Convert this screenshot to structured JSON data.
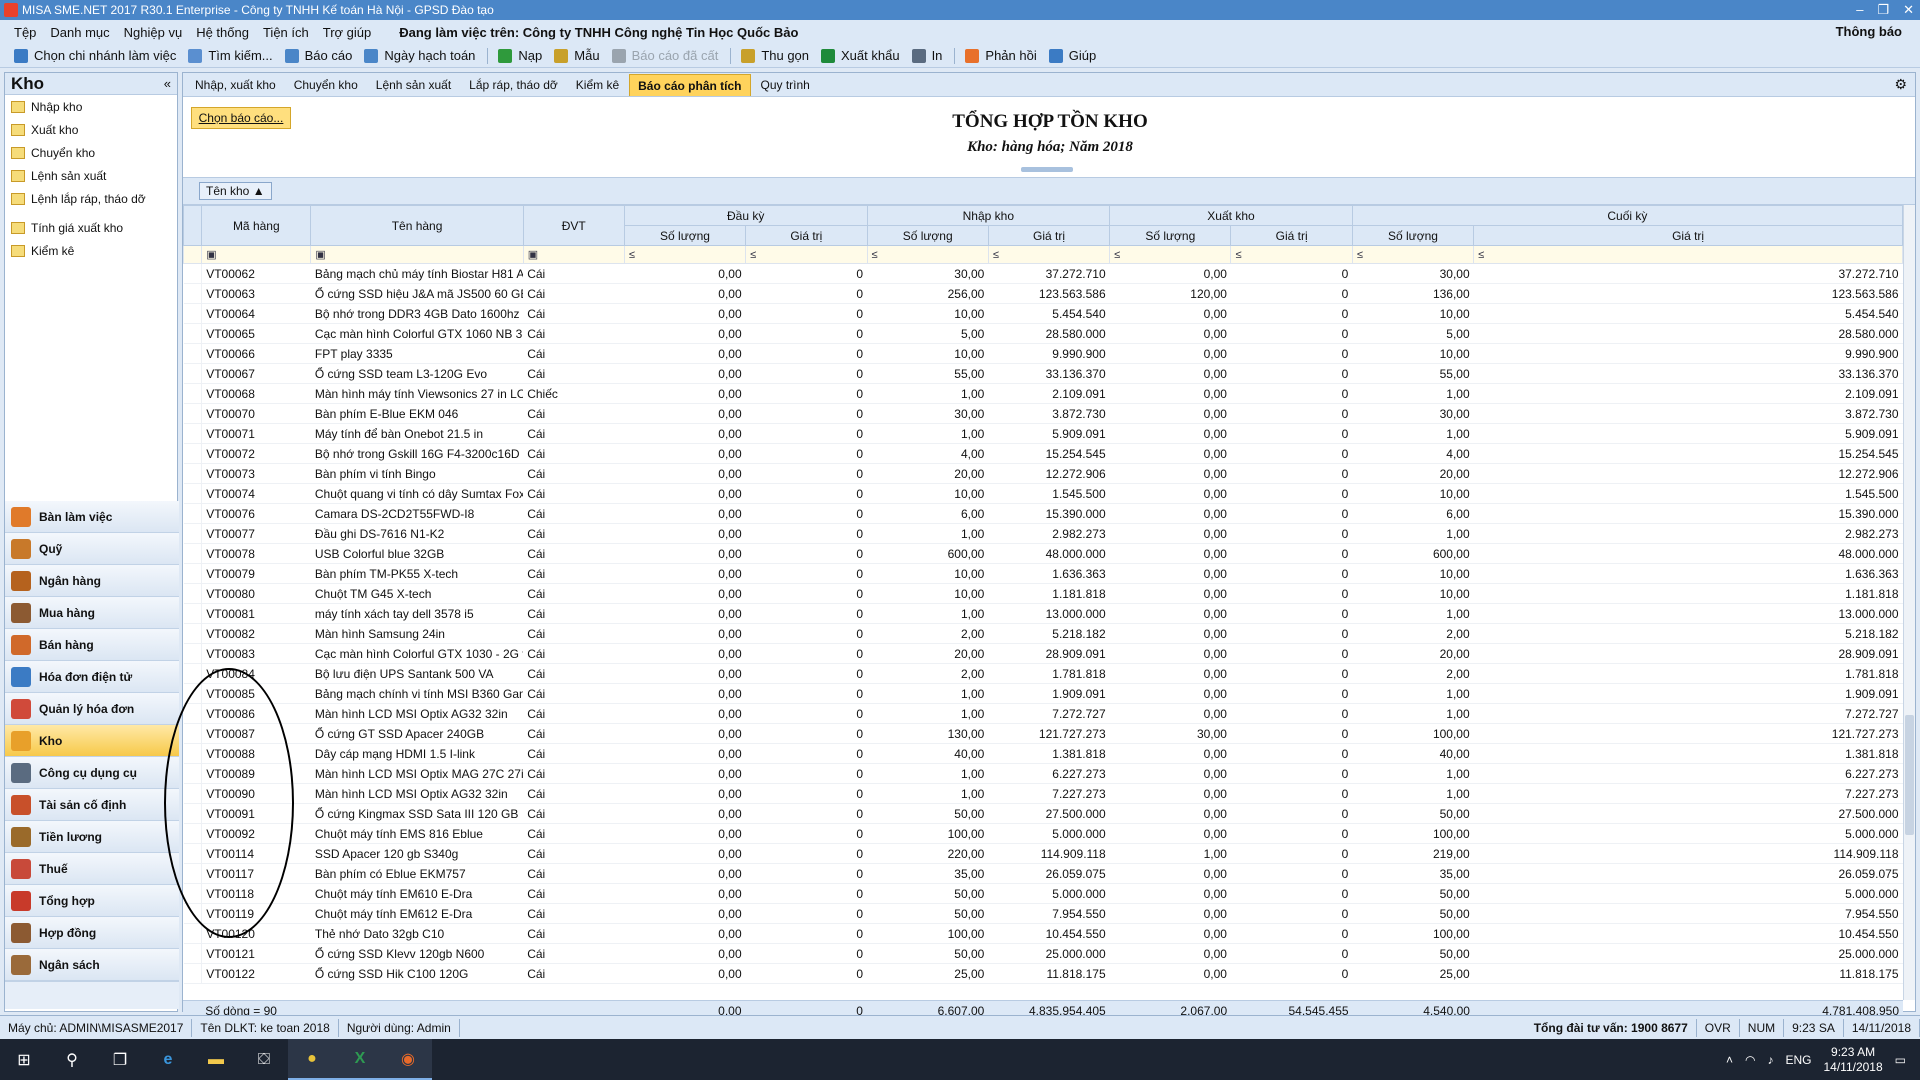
{
  "window": {
    "title": "MISA SME.NET 2017 R30.1 Enterprise - Công ty TNHH Kế toán Hà Nội - GPSD Đào tạo",
    "controls": [
      "–",
      "❐",
      "✕"
    ]
  },
  "menu": {
    "items": [
      "Tệp",
      "Danh mục",
      "Nghiệp vụ",
      "Hệ thống",
      "Tiện ích",
      "Trợ giúp"
    ],
    "working_on": "Đang làm việc trên: Công ty TNHH Công nghệ Tin Học Quốc Bảo",
    "notification": "Thông báo"
  },
  "toolbar": {
    "items": [
      {
        "label": "Chọn chi nhánh làm việc",
        "color": "#3b7bc4"
      },
      {
        "label": "Tìm kiếm...",
        "color": "#5a8fd0"
      },
      {
        "label": "Báo cáo",
        "color": "#4a86c8"
      },
      {
        "label": "Ngày hạch toán",
        "color": "#4a86c8"
      },
      {
        "label": "Nạp",
        "color": "#2f9a3c"
      },
      {
        "label": "Mẫu",
        "color": "#c8a02a"
      },
      {
        "label": "Báo cáo đã cất",
        "color": "#9aa4ae",
        "disabled": true
      },
      {
        "label": "Thu gọn",
        "color": "#c8a02a"
      },
      {
        "label": "Xuất khẩu",
        "color": "#1e8a3a"
      },
      {
        "label": "In",
        "color": "#5a6b80"
      },
      {
        "label": "Phản hồi",
        "color": "#e8702a"
      },
      {
        "label": "Giúp",
        "color": "#3b7bc4"
      }
    ]
  },
  "sidebar": {
    "title": "Kho",
    "collapse": "«",
    "items": [
      "Nhập kho",
      "Xuất kho",
      "Chuyển kho",
      "Lệnh sản xuất",
      "Lệnh lắp ráp, tháo dỡ"
    ],
    "items2": [
      "Tính giá xuất kho",
      "Kiểm kê"
    ],
    "modules": [
      "Bàn làm việc",
      "Quỹ",
      "Ngân hàng",
      "Mua hàng",
      "Bán hàng",
      "Hóa đơn điện tử",
      "Quản lý hóa đơn",
      "Kho",
      "Công cụ dụng cụ",
      "Tài sản cố định",
      "Tiền lương",
      "Thuế",
      "Tổng hợp",
      "Hợp đồng",
      "Ngân sách"
    ],
    "active_module": "Kho"
  },
  "tabs": {
    "items": [
      "Nhập, xuất kho",
      "Chuyển kho",
      "Lệnh sản xuất",
      "Lắp ráp, tháo dỡ",
      "Kiểm kê",
      "Báo cáo phân tích",
      "Quy trình"
    ],
    "active": "Báo cáo phân tích"
  },
  "report": {
    "choose_button": "Chọn báo cáo...",
    "title": "TỔNG HỢP TỒN KHO",
    "subtitle": "Kho: hàng hóa; Năm 2018",
    "group_chip": "Tên kho",
    "headers": {
      "code": "Mã hàng",
      "name": "Tên hàng",
      "unit": "ĐVT",
      "opening": "Đầu kỳ",
      "in": "Nhập kho",
      "out": "Xuất kho",
      "closing": "Cuối kỳ",
      "qty": "Số lượng",
      "value": "Giá trị"
    },
    "filter_op": "≤",
    "rows": [
      [
        "VT00062",
        "Bảng mạch chủ máy tính Biostar H81 A",
        "Cái",
        "0,00",
        "0",
        "30,00",
        "37.272.710",
        "0,00",
        "0",
        "30,00",
        "37.272.710"
      ],
      [
        "VT00063",
        "Ổ cứng SSD hiệu J&A mã JS500 60 GB",
        "Cái",
        "0,00",
        "0",
        "256,00",
        "123.563.586",
        "120,00",
        "0",
        "136,00",
        "123.563.586"
      ],
      [
        "VT00064",
        "Bộ nhớ trong DDR3 4GB Dato 1600hz",
        "Cái",
        "0,00",
        "0",
        "10,00",
        "5.454.540",
        "0,00",
        "0",
        "10,00",
        "5.454.540"
      ],
      [
        "VT00065",
        "Cạc màn hình Colorful GTX 1060 NB 3",
        "Cái",
        "0,00",
        "0",
        "5,00",
        "28.580.000",
        "0,00",
        "0",
        "5,00",
        "28.580.000"
      ],
      [
        "VT00066",
        "FPT play 3335",
        "Cái",
        "0,00",
        "0",
        "10,00",
        "9.990.900",
        "0,00",
        "0",
        "10,00",
        "9.990.900"
      ],
      [
        "VT00067",
        "Ổ cứng SSD team L3-120G Evo",
        "Cái",
        "0,00",
        "0",
        "55,00",
        "33.136.370",
        "0,00",
        "0",
        "55,00",
        "33.136.370"
      ],
      [
        "VT00068",
        "Màn hình máy tính Viewsonics 27 in LC",
        "Chiếc",
        "0,00",
        "0",
        "1,00",
        "2.109.091",
        "0,00",
        "0",
        "1,00",
        "2.109.091"
      ],
      [
        "VT00070",
        "Bàn phím E-Blue EKM 046",
        "Cái",
        "0,00",
        "0",
        "30,00",
        "3.872.730",
        "0,00",
        "0",
        "30,00",
        "3.872.730"
      ],
      [
        "VT00071",
        "Máy tính để bàn Onebot 21.5 in",
        "Cái",
        "0,00",
        "0",
        "1,00",
        "5.909.091",
        "0,00",
        "0",
        "1,00",
        "5.909.091"
      ],
      [
        "VT00072",
        "Bộ nhớ trong Gskill 16G F4-3200c16D",
        "Cái",
        "0,00",
        "0",
        "4,00",
        "15.254.545",
        "0,00",
        "0",
        "4,00",
        "15.254.545"
      ],
      [
        "VT00073",
        "Bàn phím vi tính Bingo",
        "Cái",
        "0,00",
        "0",
        "20,00",
        "12.272.906",
        "0,00",
        "0",
        "20,00",
        "12.272.906"
      ],
      [
        "VT00074",
        "Chuột quang vi tính có dây Sumtax Fox",
        "Cái",
        "0,00",
        "0",
        "10,00",
        "1.545.500",
        "0,00",
        "0",
        "10,00",
        "1.545.500"
      ],
      [
        "VT00076",
        "Camara DS-2CD2T55FWD-I8",
        "Cái",
        "0,00",
        "0",
        "6,00",
        "15.390.000",
        "0,00",
        "0",
        "6,00",
        "15.390.000"
      ],
      [
        "VT00077",
        "Đầu ghi DS-7616 N1-K2",
        "Cái",
        "0,00",
        "0",
        "1,00",
        "2.982.273",
        "0,00",
        "0",
        "1,00",
        "2.982.273"
      ],
      [
        "VT00078",
        " USB Colorful  blue 32GB",
        "Cái",
        "0,00",
        "0",
        "600,00",
        "48.000.000",
        "0,00",
        "0",
        "600,00",
        "48.000.000"
      ],
      [
        "VT00079",
        "Bàn phím TM-PK55 X-tech",
        "Cái",
        "0,00",
        "0",
        "10,00",
        "1.636.363",
        "0,00",
        "0",
        "10,00",
        "1.636.363"
      ],
      [
        "VT00080",
        "Chuột TM G45 X-tech",
        "Cái",
        "0,00",
        "0",
        "10,00",
        "1.181.818",
        "0,00",
        "0",
        "10,00",
        "1.181.818"
      ],
      [
        "VT00081",
        "máy tính xách tay dell 3578 i5",
        "Cái",
        "0,00",
        "0",
        "1,00",
        "13.000.000",
        "0,00",
        "0",
        "1,00",
        "13.000.000"
      ],
      [
        "VT00082",
        "Màn hình Samsung 24in",
        "Cái",
        "0,00",
        "0",
        "2,00",
        "5.218.182",
        "0,00",
        "0",
        "2,00",
        "5.218.182"
      ],
      [
        "VT00083",
        "Cạc màn hình Colorful GTX 1030 - 2G v",
        "Cái",
        "0,00",
        "0",
        "20,00",
        "28.909.091",
        "0,00",
        "0",
        "20,00",
        "28.909.091"
      ],
      [
        "VT00084",
        "Bộ lưu điện UPS Santank 500 VA",
        "Cái",
        "0,00",
        "0",
        "2,00",
        "1.781.818",
        "0,00",
        "0",
        "2,00",
        "1.781.818"
      ],
      [
        "VT00085",
        "Bảng mạch chính vi tính MSI B360 Gam",
        "Cái",
        "0,00",
        "0",
        "1,00",
        "1.909.091",
        "0,00",
        "0",
        "1,00",
        "1.909.091"
      ],
      [
        "VT00086",
        "Màn hình LCD MSI Optix AG32 32in",
        "Cái",
        "0,00",
        "0",
        "1,00",
        "7.272.727",
        "0,00",
        "0",
        "1,00",
        "7.272.727"
      ],
      [
        "VT00087",
        "Ổ cứng GT SSD Apacer 240GB",
        "Cái",
        "0,00",
        "0",
        "130,00",
        "121.727.273",
        "30,00",
        "0",
        "100,00",
        "121.727.273"
      ],
      [
        "VT00088",
        "Dây cáp mạng HDMI 1.5 I-link",
        "Cái",
        "0,00",
        "0",
        "40,00",
        "1.381.818",
        "0,00",
        "0",
        "40,00",
        "1.381.818"
      ],
      [
        "VT00089",
        "Màn hình LCD MSI Optix MAG 27C 27i",
        "Cái",
        "0,00",
        "0",
        "1,00",
        "6.227.273",
        "0,00",
        "0",
        "1,00",
        "6.227.273"
      ],
      [
        "VT00090",
        "Màn hình LCD MSI Optix AG32 32in",
        "Cái",
        "0,00",
        "0",
        "1,00",
        "7.227.273",
        "0,00",
        "0",
        "1,00",
        "7.227.273"
      ],
      [
        "VT00091",
        "Ổ cứng Kingmax SSD Sata III 120 GB",
        "Cái",
        "0,00",
        "0",
        "50,00",
        "27.500.000",
        "0,00",
        "0",
        "50,00",
        "27.500.000"
      ],
      [
        "VT00092",
        "Chuột máy tính EMS 816 Eblue",
        "Cái",
        "0,00",
        "0",
        "100,00",
        "5.000.000",
        "0,00",
        "0",
        "100,00",
        "5.000.000"
      ],
      [
        "VT00114",
        "SSD Apacer 120 gb S340g",
        "Cái",
        "0,00",
        "0",
        "220,00",
        "114.909.118",
        "1,00",
        "0",
        "219,00",
        "114.909.118"
      ],
      [
        "VT00117",
        "Bàn phím có Eblue EKM757",
        "Cái",
        "0,00",
        "0",
        "35,00",
        "26.059.075",
        "0,00",
        "0",
        "35,00",
        "26.059.075"
      ],
      [
        "VT00118",
        "Chuột máy tính EM610 E-Dra",
        "Cái",
        "0,00",
        "0",
        "50,00",
        "5.000.000",
        "0,00",
        "0",
        "50,00",
        "5.000.000"
      ],
      [
        "VT00119",
        "Chuột máy tính EM612 E-Dra",
        "Cái",
        "0,00",
        "0",
        "50,00",
        "7.954.550",
        "0,00",
        "0",
        "50,00",
        "7.954.550"
      ],
      [
        "VT00120",
        "Thẻ nhớ Dato 32gb C10",
        "Cái",
        "0,00",
        "0",
        "100,00",
        "10.454.550",
        "0,00",
        "0",
        "100,00",
        "10.454.550"
      ],
      [
        "VT00121",
        "Ổ cứng SSD Klevv 120gb N600",
        "Cái",
        "0,00",
        "0",
        "50,00",
        "25.000.000",
        "0,00",
        "0",
        "50,00",
        "25.000.000"
      ],
      [
        "VT00122",
        "Ổ cứng SSD Hik C100 120G",
        "Cái",
        "0,00",
        "0",
        "25,00",
        "11.818.175",
        "0,00",
        "0",
        "25,00",
        "11.818.175"
      ]
    ],
    "footer": {
      "count": "Số dòng = 90",
      "open_qty": "0,00",
      "open_val": "0",
      "in_qty": "6.607,00",
      "in_val": "4.835.954.405",
      "out_qty": "2.067,00",
      "out_val": "54.545.455",
      "close_qty": "4.540,00",
      "close_val": "4.781.408.950"
    }
  },
  "statusbar": {
    "server": "Máy chủ: ADMIN\\MISASME2017",
    "db": "Tên DLKT: ke toan 2018",
    "user": "Người dùng: Admin",
    "hotline": "Tổng đài tư vấn: 1900 8677",
    "ovr": "OVR",
    "num": "NUM",
    "time": "9:23 SA",
    "date": "14/11/2018"
  },
  "taskbar": {
    "lang": "ENG",
    "time": "9:23 AM",
    "date": "14/11/2018"
  }
}
